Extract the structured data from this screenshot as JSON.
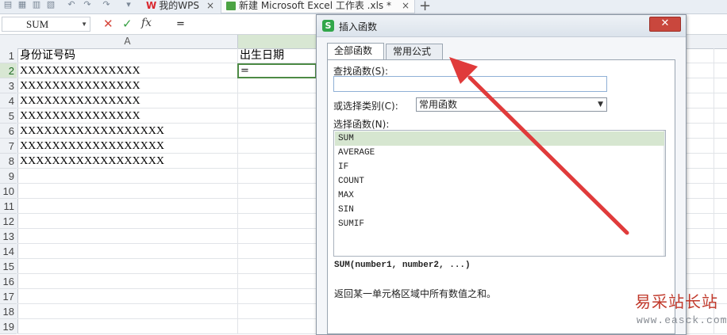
{
  "tabs": {
    "wps_label": "我的WPS",
    "file_label": "新建 Microsoft Excel 工作表 .xls *",
    "close_glyph": "×",
    "add_glyph": "+"
  },
  "formula_bar": {
    "name_box": "SUM",
    "cancel_glyph": "✕",
    "ok_glyph": "✓",
    "fx_label": "fx",
    "value": "="
  },
  "columns": {
    "A": "A"
  },
  "rows": [
    "1",
    "2",
    "3",
    "4",
    "5",
    "6",
    "7",
    "8",
    "9",
    "10",
    "11",
    "12",
    "13",
    "14",
    "15",
    "16",
    "17",
    "18",
    "19"
  ],
  "active_row": "2",
  "cells": {
    "A1": "身份证号码",
    "B1": "出生日期",
    "A2": "XXXXXXXXXXXXXXX",
    "A3": "XXXXXXXXXXXXXXX",
    "A4": "XXXXXXXXXXXXXXX",
    "A5": "XXXXXXXXXXXXXXX",
    "A6": "XXXXXXXXXXXXXXXXXX",
    "A7": "XXXXXXXXXXXXXXXXXX",
    "A8": "XXXXXXXXXXXXXXXXXX",
    "B2": "="
  },
  "dialog": {
    "logo": "S",
    "title": "插入函数",
    "close_glyph": "✕",
    "tab_all": "全部函数",
    "tab_common": "常用公式",
    "search_label": "查找函数(S):",
    "search_value": "",
    "category_label": "或选择类别(C):",
    "category_value": "常用函数",
    "function_label": "选择函数(N):",
    "functions": [
      "SUM",
      "AVERAGE",
      "IF",
      "COUNT",
      "MAX",
      "SIN",
      "SUMIF"
    ],
    "selected_function": "SUM",
    "signature": "SUM(number1, number2, ...)",
    "description": "返回某一单元格区域中所有数值之和。"
  },
  "watermark": {
    "cn": "易采站长站",
    "url": "www.easck.com"
  },
  "colors": {
    "annotation_arrow": "#e03b3b",
    "selection_green": "#4d8a45",
    "watermark_red": "#c0392b"
  }
}
